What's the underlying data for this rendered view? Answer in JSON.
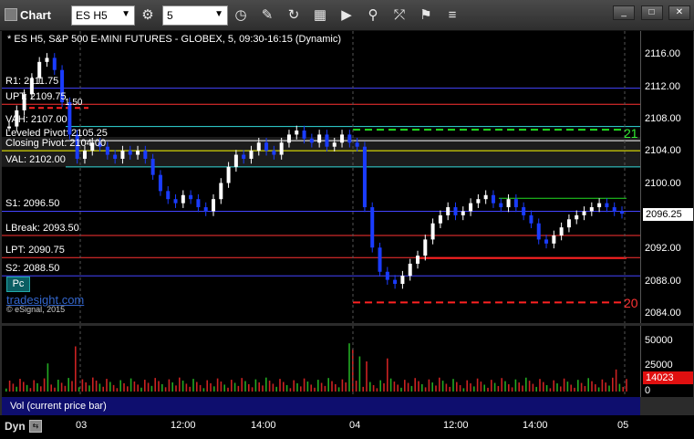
{
  "app": {
    "title": "Chart",
    "logo_icon": "chart-window-icon"
  },
  "toolbar": {
    "symbol": "ES H5",
    "interval": "5",
    "tools": [
      "settings-gear-icon",
      "clock-icon",
      "pencil-icon",
      "refresh-icon",
      "study-icon",
      "play-icon",
      "link-icon",
      "cursor-icon",
      "tag-icon",
      "menu-icon"
    ]
  },
  "window_buttons": [
    "minimize-button",
    "maximize-button",
    "close-button"
  ],
  "chart": {
    "header": "* ES H5, S&P 500 E-MINI FUTURES - GLOBEX, 5, 09:30-16:15 (Dynamic)",
    "price_ticks": [
      "2116.00",
      "2112.00",
      "2108.00",
      "2104.00",
      "2100.00",
      "2092.00",
      "2088.00",
      "2084.00"
    ],
    "current_price": "2096.25",
    "levels": [
      {
        "label": "R1: 2111.75",
        "color": "#4444ff"
      },
      {
        "label": "UPT: 2109.75",
        "color": "#ff3333"
      },
      {
        "label": "VAH: 2107.00",
        "color": "#33dddd"
      },
      {
        "label": "Leveled Pivot: 2105.25",
        "color": "#ffffff"
      },
      {
        "label": "Closing Pivot: 2104.00",
        "color": "#ffff00"
      },
      {
        "label": "VAL: 2102.00",
        "color": "#33dddd"
      },
      {
        "label": "S1: 2096.50",
        "color": "#4444ff"
      },
      {
        "label": "LBreak: 2093.50",
        "color": "#ff3333"
      },
      {
        "label": "LPT: 2090.75",
        "color": "#ff3333"
      },
      {
        "label": "S2: 2088.50",
        "color": "#4444ff"
      }
    ],
    "annotations": {
      "num_21": "21",
      "num_20": "20",
      "num_150": "1.50"
    },
    "pc_label": "Pc",
    "brand": "tradesight.com",
    "copyright": "© eSignal, 2015"
  },
  "volume": {
    "label": "Vol (current price bar)",
    "ticks": [
      "50000",
      "25000",
      "0"
    ],
    "current": "14023"
  },
  "time_axis": {
    "labels": [
      "03",
      "12:00",
      "14:00",
      "04",
      "12:00",
      "14:00",
      "05"
    ],
    "dyn_label": "Dyn"
  },
  "colors": {
    "up": "#ffffff",
    "down": "#1a3cff",
    "panel_bg": "#000000"
  }
}
